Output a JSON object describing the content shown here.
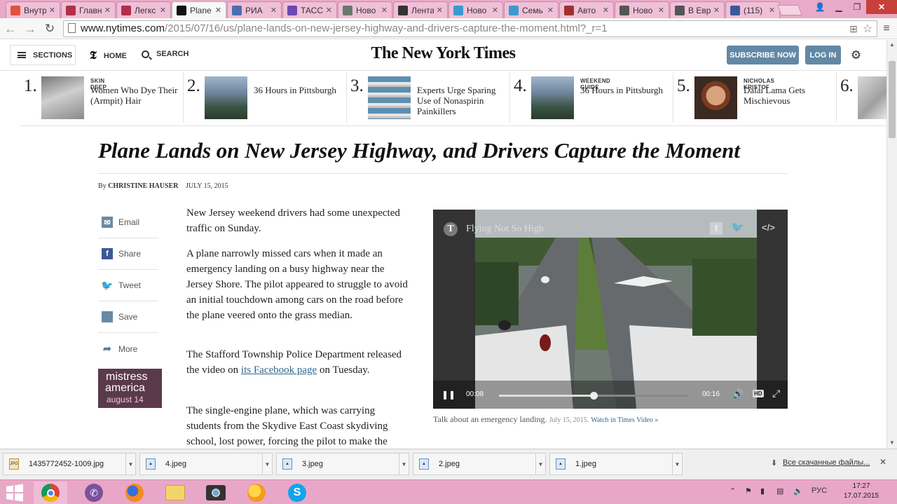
{
  "browser": {
    "tabs": [
      {
        "label": "Внутр",
        "icon": "red-dot-icon",
        "color": "#e2513a"
      },
      {
        "label": "Главн",
        "icon": "t-letter-icon",
        "color": "#b0304a"
      },
      {
        "label": "Легкс",
        "icon": "t-letter-icon",
        "color": "#b0304a"
      },
      {
        "label": "Plane",
        "icon": "nyt-icon",
        "color": "#111111",
        "active": true
      },
      {
        "label": "РИА",
        "icon": "ria-icon",
        "color": "#4a6fb0"
      },
      {
        "label": "ТАСС",
        "icon": "tass-icon",
        "color": "#6a4ab0"
      },
      {
        "label": "Ново",
        "icon": "globe-icon",
        "color": "#6a7a6a"
      },
      {
        "label": "Лента",
        "icon": "lenta-icon",
        "color": "#333333"
      },
      {
        "label": "Ново",
        "icon": "f-script-icon",
        "color": "#3a9ad0"
      },
      {
        "label": "Семь",
        "icon": "f-script-icon",
        "color": "#3a9ad0"
      },
      {
        "label": "Авто",
        "icon": "auto-icon",
        "color": "#a03030"
      },
      {
        "label": "Ново",
        "icon": "doc-icon",
        "color": "#555555"
      },
      {
        "label": "В Евр",
        "icon": "doc-icon",
        "color": "#555555"
      },
      {
        "label": "(115)",
        "icon": "facebook-icon",
        "color": "#3b5998"
      }
    ],
    "url_host": "www.nytimes.com",
    "url_path": "/2015/07/16/us/plane-lands-on-new-jersey-highway-and-drivers-capture-the-moment.html?_r=1"
  },
  "nyt": {
    "sections_label": "SECTIONS",
    "home_label": "HOME",
    "search_label": "SEARCH",
    "logo": "The New York Times",
    "subscribe_label": "SUBSCRIBE NOW",
    "login_label": "LOG IN"
  },
  "ribbon": [
    {
      "num": "1.",
      "kicker": "SKIN DEEP",
      "title": "Women Who Dye Their (Armpit) Hair"
    },
    {
      "num": "2.",
      "kicker": "",
      "title": "36 Hours in Pittsburgh"
    },
    {
      "num": "3.",
      "kicker": "",
      "title": "Experts Urge Sparing Use of Nonaspirin Painkillers"
    },
    {
      "num": "4.",
      "kicker": "WEEKEND GUIDE",
      "title": "36 Hours in Pittsburgh"
    },
    {
      "num": "5.",
      "kicker": "NICHOLAS KRISTOF",
      "title": "Dalai Lama Gets Mischievous"
    },
    {
      "num": "6.",
      "kicker": "",
      "title": ""
    }
  ],
  "article": {
    "headline": "Plane Lands on New Jersey Highway, and Drivers Capture the Moment",
    "by": "By",
    "author": "CHRISTINE HAUSER",
    "date": "JULY 15, 2015",
    "paragraphs": {
      "p1": "New Jersey weekend drivers had some unexpected traffic on Sunday.",
      "p2": "A plane narrowly missed cars when it made an emergency landing on a busy highway near the Jersey Shore. The pilot appeared to struggle to avoid an initial touchdown among cars on the road before the plane veered onto the grass median.",
      "p3_before": "The Stafford Township Police Department released the video on ",
      "p3_link": "its Facebook page",
      "p3_after": " on Tuesday.",
      "p4": "The single-engine plane, which was carrying students from the Skydive East Coast skydiving school, lost power, forcing the pilot to make the"
    }
  },
  "share": [
    {
      "label": "Email",
      "icon": "email-icon"
    },
    {
      "label": "Share",
      "icon": "facebook-icon"
    },
    {
      "label": "Tweet",
      "icon": "twitter-icon"
    },
    {
      "label": "Save",
      "icon": "folder-icon"
    },
    {
      "label": "More",
      "icon": "share-arrow-icon"
    }
  ],
  "ad": {
    "line1": "mistress",
    "line2": "america",
    "line3": "august 14"
  },
  "video": {
    "title": "Flying Not So High",
    "time_elapsed": "00:08",
    "time_total": "00:16",
    "progress": 0.5,
    "caption": "Talk about an emergency landing.",
    "caption_date": "July 15, 2015.",
    "caption_link": "Watch in Times Video »"
  },
  "downloads": {
    "items": [
      "1435772452-1009.jpg",
      "4.jpeg",
      "3.jpeg",
      "2.jpeg",
      "1.jpeg"
    ],
    "show_all": "Все скачанные файлы..."
  },
  "taskbar": {
    "lang": "РУС",
    "time": "17:27",
    "date": "17.07.2015"
  }
}
